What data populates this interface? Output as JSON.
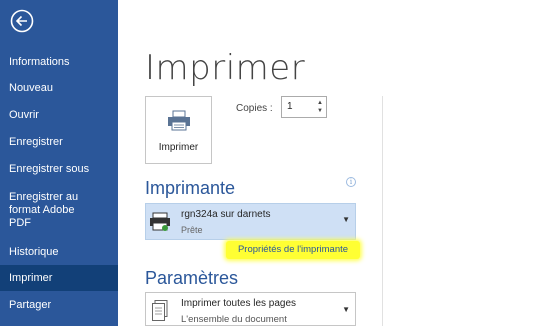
{
  "sidebar": {
    "items": [
      {
        "label": "Informations",
        "name": "sidebar-item-informations"
      },
      {
        "label": "Nouveau",
        "name": "sidebar-item-nouveau"
      },
      {
        "label": "Ouvrir",
        "name": "sidebar-item-ouvrir"
      },
      {
        "label": "Enregistrer",
        "name": "sidebar-item-enregistrer"
      },
      {
        "label": "Enregistrer sous",
        "name": "sidebar-item-enregistrer-sous"
      },
      {
        "label": "Enregistrer au\nformat Adobe\nPDF",
        "name": "sidebar-item-enregistrer-pdf"
      },
      {
        "label": "Historique",
        "name": "sidebar-item-historique"
      },
      {
        "label": "Imprimer",
        "name": "sidebar-item-imprimer",
        "active": true
      },
      {
        "label": "Partager",
        "name": "sidebar-item-partager"
      }
    ],
    "back_icon": "arrow-left-circle-icon",
    "color": "#2b579a",
    "active_color": "#124078"
  },
  "main": {
    "title": "Imprimer",
    "print_button_label": "Imprimer",
    "copies_label": "Copies :",
    "copies_value": "1",
    "printer_heading": "Imprimante",
    "printer": {
      "name": "rgn324a sur darnets",
      "status": "Prête"
    },
    "printer_properties_link": "Propriétés de l'imprimante",
    "settings_heading": "Paramètres",
    "pages_setting": {
      "name": "Imprimer toutes les pages",
      "sub": "L'ensemble du document"
    },
    "info_icon": "info-icon",
    "highlight_color": "#ffff33",
    "accent_color": "#2b579a"
  }
}
